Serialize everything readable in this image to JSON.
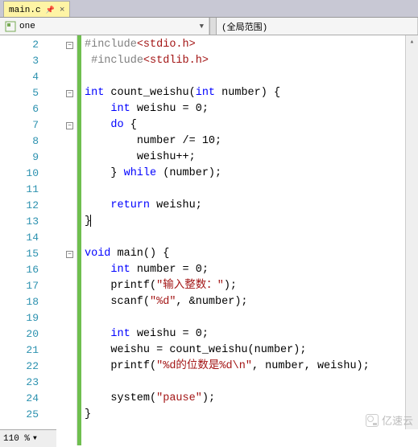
{
  "tab": {
    "filename": "main.c",
    "pinned": true
  },
  "dropdown": {
    "left": "one",
    "right": "(全局范围)"
  },
  "line_numbers": [
    "2",
    "3",
    "4",
    "5",
    "6",
    "7",
    "8",
    "9",
    "10",
    "11",
    "12",
    "13",
    "14",
    "15",
    "16",
    "17",
    "18",
    "19",
    "20",
    "21",
    "22",
    "23",
    "24",
    "25"
  ],
  "code": {
    "l2": {
      "pre": "#include",
      "inc": "<stdio.h>"
    },
    "l3": {
      "pre": "#include",
      "inc": "<stdlib.h>"
    },
    "l5": {
      "k1": "int",
      "fn": " count_weishu(",
      "k2": "int",
      "rest": " number) {"
    },
    "l6": {
      "k": "int",
      "rest": " weishu = 0;"
    },
    "l7": {
      "k": "do",
      "rest": " {"
    },
    "l8": "number /= 10;",
    "l9": "weishu++;",
    "l10": {
      "a": "} ",
      "k": "while",
      "b": " (number);"
    },
    "l12": {
      "k": "return",
      "rest": " weishu;"
    },
    "l13": "}",
    "l15": {
      "k1": "void",
      "fn": " main() {"
    },
    "l16": {
      "k": "int",
      "rest": " number = 0;"
    },
    "l17": {
      "a": "printf(",
      "s": "\"输入整数：\"",
      "b": ");"
    },
    "l18": {
      "a": "scanf(",
      "s": "\"%d\"",
      "b": ", &number);"
    },
    "l20": {
      "k": "int",
      "rest": " weishu = 0;"
    },
    "l21": "weishu = count_weishu(number);",
    "l22": {
      "a": "printf(",
      "s": "\"%d的位数是%d\\n\"",
      "b": ", number, weishu);"
    },
    "l24": {
      "a": "system(",
      "s": "\"pause\"",
      "b": ");"
    },
    "l25": "}"
  },
  "zoom": "110 %",
  "watermark": "亿速云",
  "chart_data": null
}
